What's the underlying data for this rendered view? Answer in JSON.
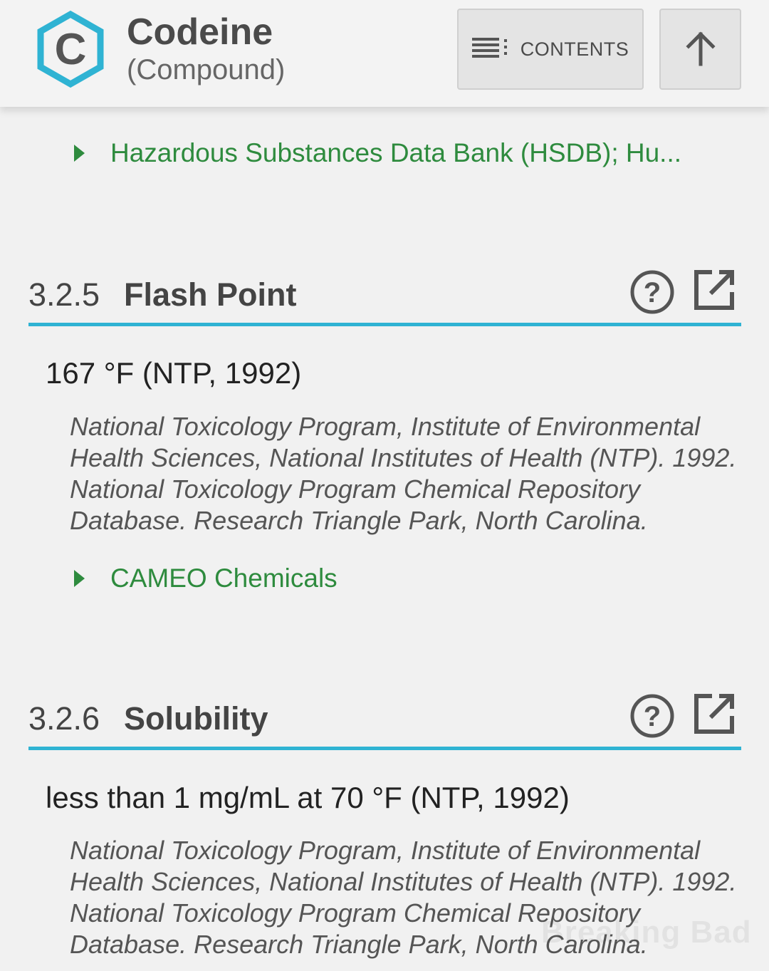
{
  "header": {
    "logo_letter": "C",
    "title": "Codeine",
    "subtitle": "(Compound)",
    "contents_label": "CONTENTS"
  },
  "links": {
    "hsdb": "Hazardous Substances Data Bank (HSDB); Hu...",
    "cameo": "CAMEO Chemicals"
  },
  "sections": [
    {
      "number": "3.2.5",
      "title": "Flash Point",
      "value": "167 °F (NTP, 1992)",
      "citation": "National Toxicology Program, Institute of Environmental Health Sciences, National Institutes of Health (NTP). 1992. National Toxicology Program Chemical Repository Database. Research Triangle Park, North Carolina."
    },
    {
      "number": "3.2.6",
      "title": "Solubility",
      "value": "less than 1 mg/mL at 70 °F (NTP, 1992)",
      "citation": "National Toxicology Program, Institute of Environmental Health Sciences, National Institutes of Health (NTP). 1992. National Toxicology Program Chemical Repository Database. Research Triangle Park, North Carolina."
    }
  ],
  "watermark": "Breaking Bad",
  "colors": {
    "link": "#2e8b3e",
    "accent_rule": "#2fb3d3",
    "logo_hex": "#2fb3d3"
  }
}
